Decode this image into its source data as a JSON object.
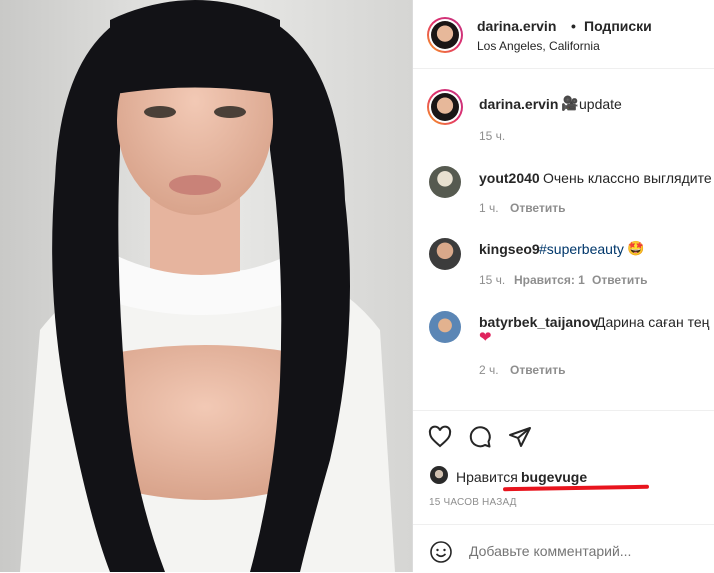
{
  "post": {
    "author": "darina.ervin",
    "separator": "•",
    "follow_label": "Подписки",
    "location": "Los Angeles, California"
  },
  "caption": {
    "author": "darina.ervin",
    "emoji": "🎥",
    "text": "update",
    "time": "15 ч."
  },
  "comments": [
    {
      "user": "yout2040",
      "text": "Очень классно выглядите",
      "time": "1 ч.",
      "likes": "",
      "reply": "Ответить"
    },
    {
      "user": "kingseo9",
      "hashtag": "#superbeauty",
      "emoji": "🤩",
      "time": "15 ч.",
      "likes": "Нравится: 1",
      "reply": "Ответить"
    },
    {
      "user": "batyrbek_taijanov",
      "text": "Дарина саған тең",
      "emoji": "❤",
      "time": "2 ч.",
      "likes": "",
      "reply": "Ответить"
    }
  ],
  "likes": {
    "prefix": "Нравится",
    "user": "bugevuge",
    "timestamp": "15 ЧАСОВ НАЗАД"
  },
  "comment_input": {
    "placeholder": "Добавьте комментарий..."
  },
  "icons": [
    "heart-icon",
    "comment-icon",
    "share-icon",
    "emoji-icon"
  ],
  "colors": {
    "annotation_red": "#e8141d",
    "text": "#262626",
    "secondary": "#8e8e8e",
    "hashtag": "#00376b"
  }
}
